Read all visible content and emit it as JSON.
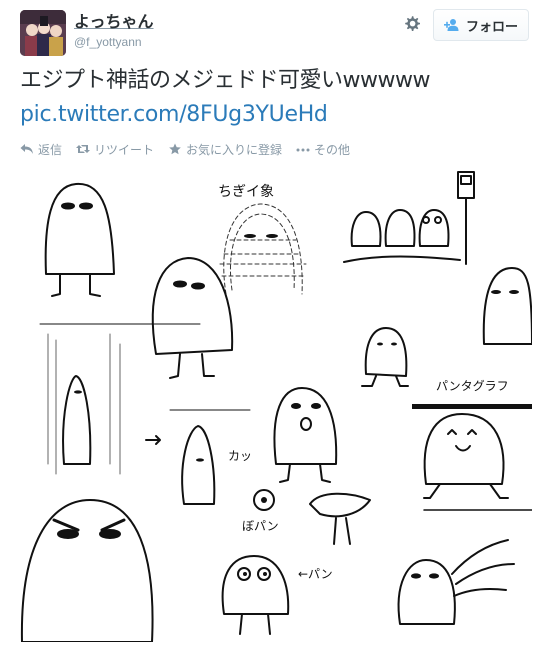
{
  "user": {
    "display_name": "よっちゃん",
    "screen_name": "@f_yottyann",
    "avatar_icon": "user-avatar"
  },
  "header": {
    "settings_icon": "gear-icon",
    "follow_button_label": "フォロー",
    "follow_icon": "add-user-icon"
  },
  "tweet": {
    "text": "エジプト神話のメジェドド可愛いwwwww",
    "link": "pic.twitter.com/8FUg3YUeHd"
  },
  "actions": [
    {
      "label": "返信",
      "icon": "reply-icon"
    },
    {
      "label": "リツイート",
      "icon": "retweet-icon"
    },
    {
      "label": "お気に入りに登録",
      "icon": "star-icon"
    },
    {
      "label": "その他",
      "icon": "more-icon"
    }
  ],
  "media": {
    "annotations": {
      "chigiri": "ちぎイ象",
      "katsu": "カッ",
      "bapon": "ぼパン",
      "pan": "←パン",
      "panta": "パンタグラフ"
    }
  },
  "colors": {
    "link": "#2b7bb9",
    "muted": "#8899a6",
    "text": "#292f33",
    "border": "#e1e8ed"
  }
}
